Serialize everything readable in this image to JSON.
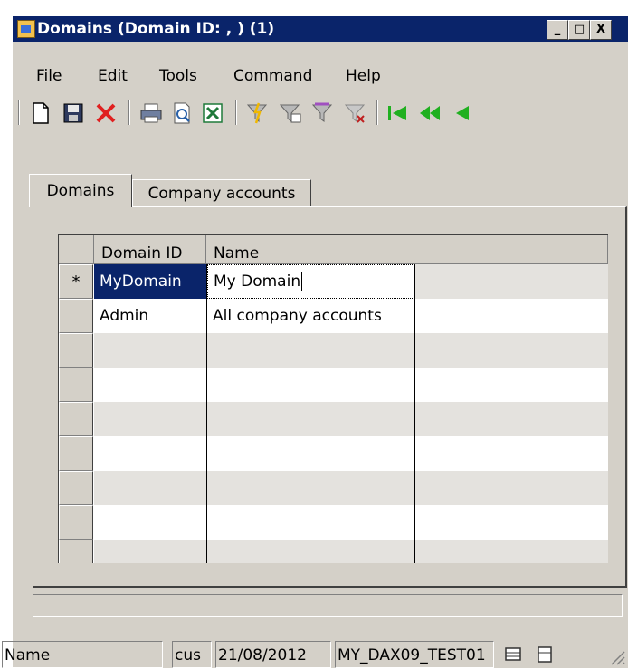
{
  "window": {
    "title": "Domains (Domain ID: , ) (1)",
    "buttons": [
      "_",
      "□",
      "X"
    ]
  },
  "menu": [
    "File",
    "Edit",
    "Tools",
    "Command",
    "Help"
  ],
  "toolbar": {
    "icons": [
      "new-icon",
      "save-icon",
      "delete-icon",
      "print-icon",
      "print-preview-icon",
      "export-excel-icon",
      "filter-by-selection-icon",
      "filter-by-grid-icon",
      "advanced-filter-icon",
      "remove-filter-icon",
      "first-record-icon",
      "previous-page-icon",
      "previous-record-icon"
    ]
  },
  "tabs": [
    {
      "label": "Domains",
      "active": true
    },
    {
      "label": "Company accounts",
      "active": false
    }
  ],
  "grid": {
    "columns": [
      "Domain ID",
      "Name"
    ],
    "rows": [
      {
        "marker": "*",
        "domain_id": "MyDomain",
        "name": "My Domain"
      },
      {
        "marker": "",
        "domain_id": "Admin",
        "name": "All company accounts"
      }
    ],
    "empty_rows": 7
  },
  "status": {
    "field": "Name",
    "company": "cus",
    "date": "21/08/2012",
    "server": "MY_DAX09_TEST01"
  },
  "colors": {
    "title_bg": "#0a246a",
    "selected_cell": "#0a246a",
    "face": "#d4d0c8"
  }
}
